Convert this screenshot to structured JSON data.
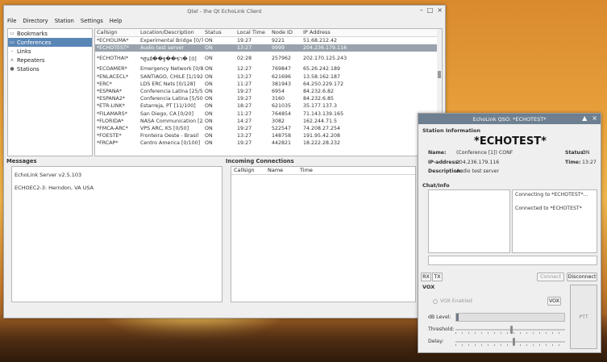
{
  "window": {
    "title": "Qtel - the Qt EchoLink Client",
    "controls": [
      "–",
      "□",
      "×"
    ]
  },
  "menu": [
    "File",
    "Directory",
    "Station",
    "Settings",
    "Help"
  ],
  "tree": [
    {
      "label": "Bookmarks",
      "icon": "bookmark-icon",
      "selected": false
    },
    {
      "label": "Conferences",
      "icon": "conference-icon",
      "selected": true
    },
    {
      "label": "Links",
      "icon": "link-icon",
      "selected": false
    },
    {
      "label": "Repeaters",
      "icon": "repeater-icon",
      "selected": false
    },
    {
      "label": "Stations",
      "icon": "station-icon",
      "selected": false
    }
  ],
  "stations_table": {
    "columns": [
      "Callsign",
      "Location/Description",
      "Status",
      "Local Time",
      "Node ID",
      "IP Address"
    ],
    "rows": [
      [
        "*ECHOLIMA*",
        "Experimental Bridge [0/73...",
        "ON",
        "19:27",
        "9221",
        "51.68.212.42"
      ],
      [
        "*ECHOTEST*",
        "Audio test server",
        "ON",
        "13:27",
        "9999",
        "204.236.179.116"
      ],
      [
        "*ECHOTHAI*",
        "*ศูนย์��ฐ��ข่า� [0]",
        "ON",
        "02:28",
        "257962",
        "202.170.125.243"
      ],
      [
        "*ECOAMER*",
        "Emergency Network [0/8]",
        "ON",
        "12:27",
        "769847",
        "65.26.242.189"
      ],
      [
        "*ENLACECL*",
        "SANTIAGO, CHILE [1/1922]",
        "ON",
        "13:27",
        "621696",
        "13.58.162.187"
      ],
      [
        "*ERC*",
        "LDS ERC Nets [0/128]",
        "ON",
        "11:27",
        "381943",
        "64.250.229.172"
      ],
      [
        "*ESPANA*",
        "Conferencia Latina [25/50...",
        "ON",
        "19:27",
        "6954",
        "84.232.6.82"
      ],
      [
        "*ESPANA2*",
        "Conferencia Latina [5/500]",
        "ON",
        "19:27",
        "3160",
        "84.232.6.85"
      ],
      [
        "*ETR-LINK*",
        "Estarreja, PT [11/100]",
        "ON",
        "18:27",
        "621035",
        "35.177.137.3"
      ],
      [
        "*FILAMARS*",
        "San Diego, CA [0/20]",
        "ON",
        "11:27",
        "764854",
        "71.143.139.165"
      ],
      [
        "*FLORIDA*",
        "NASA Communication [2/...",
        "ON",
        "14:27",
        "3082",
        "162.244.71.5"
      ],
      [
        "*FMCA-ARC*",
        "VPS ARC, KS [0/50]",
        "ON",
        "19:27",
        "522547",
        "74.208.27.254"
      ],
      [
        "*FOESTE*",
        "Fronteira Oeste - Brasil",
        "ON",
        "13:27",
        "148758",
        "191.95.42.208"
      ],
      [
        "*FRCAP*",
        "Centro America [0/100]",
        "ON",
        "19:27",
        "442821",
        "18.222.28.232"
      ]
    ]
  },
  "messages": {
    "label": "Messages",
    "lines": [
      "EchoLink Server v2.5.103",
      "ECHOEC2-3: Herndon, VA USA"
    ]
  },
  "incoming": {
    "label": "Incoming Connections",
    "columns": [
      "Callsign",
      "Name",
      "Time"
    ]
  },
  "qso": {
    "title": "EchoLink QSO: *ECHOTEST*",
    "controls": [
      "▲",
      "×"
    ],
    "station_info_label": "Station Information",
    "callsign": "*ECHOTEST*",
    "name_label": "Name:",
    "name_value": "(Conference  [1]) CONF",
    "ip_label": "IP-address:",
    "ip_value": "204.236.179.116",
    "desc_label": "Description:",
    "desc_value": "Audio test server",
    "status_label": "Status:",
    "status_value": "ON",
    "time_label": "Time:",
    "time_value": "13:27",
    "chat_label": "Chat/Info",
    "info_lines": [
      "Connecting to *ECHOTEST*...",
      "Connected to *ECHOTEST*"
    ],
    "tab_rx": "RX",
    "tab_tx": "TX",
    "connect": "Connect",
    "disconnect": "Disconnect",
    "vox_label": "VOX",
    "vox_enabled": "VOX Enabled",
    "vox_button": "VOX",
    "db_level": "dB Level:",
    "threshold": "Threshold:",
    "delay": "Delay:",
    "ptt": "PTT",
    "level_fill": 0.02,
    "threshold_pos": 0.5,
    "delay_pos": 0.52
  },
  "colors": {
    "selected_tree": "#5a86b6",
    "selected_row": "#9aa3ad",
    "dialog_title": "#6d7f90"
  }
}
